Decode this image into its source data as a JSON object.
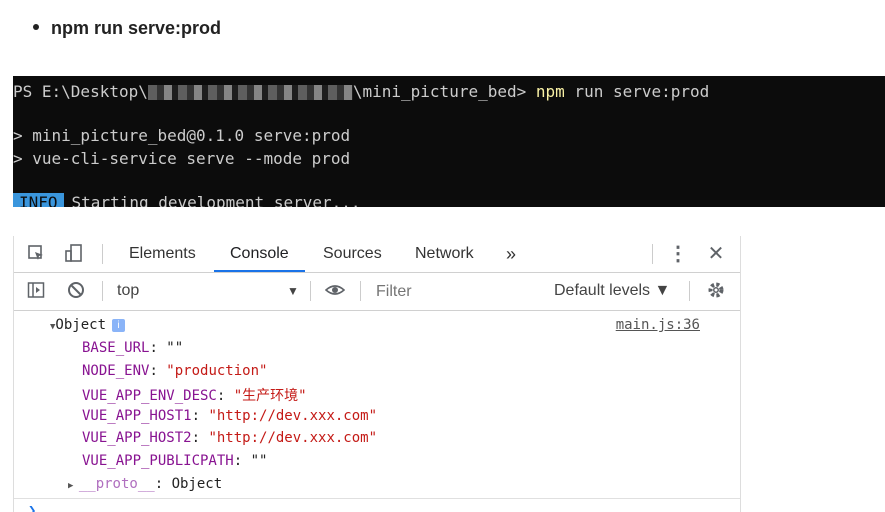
{
  "doc": {
    "bullet_text": "npm run serve:prod"
  },
  "terminal": {
    "prompt_prefix": "PS E:\\Desktop\\",
    "prompt_suffix": "\\mini_picture_bed> ",
    "cmd": "npm",
    "cmd_args": " run serve:prod",
    "line2": "> mini_picture_bed@0.1.0 serve:prod",
    "line3": "> vue-cli-service serve --mode prod",
    "info_badge": "INFO",
    "info_text": "Starting development server..."
  },
  "devtools": {
    "tabs": [
      "Elements",
      "Console",
      "Sources",
      "Network"
    ],
    "more_tabs": "»",
    "context": "top",
    "filter_placeholder": "Filter",
    "levels": "Default levels ▼",
    "source": "main.js:36"
  },
  "console": {
    "object_label": "Object",
    "props": [
      {
        "k": "BASE_URL",
        "v": "\"\""
      },
      {
        "k": "NODE_ENV",
        "v": "\"production\""
      },
      {
        "k": "VUE_APP_ENV_DESC",
        "v": "\"生产环境\""
      },
      {
        "k": "VUE_APP_HOST1",
        "v": "\"http://dev.xxx.com\""
      },
      {
        "k": "VUE_APP_HOST2",
        "v": "\"http://dev.xxx.com\""
      },
      {
        "k": "VUE_APP_PUBLICPATH",
        "v": "\"\""
      }
    ],
    "proto_key": "__proto__",
    "proto_val": "Object"
  }
}
